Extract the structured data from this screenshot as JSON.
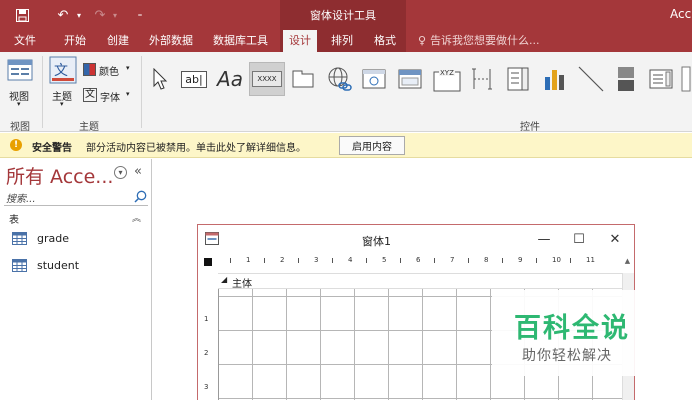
{
  "titlebar": {
    "context_title": "窗体设计工具",
    "app_title": "Acc"
  },
  "tabs": [
    {
      "label": "文件"
    },
    {
      "label": "开始"
    },
    {
      "label": "创建"
    },
    {
      "label": "外部数据"
    },
    {
      "label": "数据库工具"
    },
    {
      "label": "设计"
    },
    {
      "label": "排列"
    },
    {
      "label": "格式"
    }
  ],
  "active_tab": "设计",
  "tell_me": "告诉我您想要做什么...",
  "ribbon": {
    "view_label": "视图",
    "theme_label": "主题",
    "color_label": "颜色",
    "font_label": "字体",
    "groups": {
      "views": "视图",
      "themes": "主题",
      "controls": "控件"
    },
    "controls": [
      {
        "icon": "select-pointer-icon"
      },
      {
        "icon": "textbox-icon",
        "text": "ab|"
      },
      {
        "icon": "label-icon",
        "text": "Aa"
      },
      {
        "icon": "button-icon",
        "text": "XXXX"
      },
      {
        "icon": "tab-control-icon"
      },
      {
        "icon": "hyperlink-icon"
      },
      {
        "icon": "web-browser-icon"
      },
      {
        "icon": "navigation-control-icon"
      },
      {
        "icon": "option-group-icon",
        "text": "XYZ"
      },
      {
        "icon": "page-break-icon"
      },
      {
        "icon": "combo-box-icon"
      },
      {
        "icon": "chart-icon"
      },
      {
        "icon": "line-icon"
      },
      {
        "icon": "toggle-button-icon"
      },
      {
        "icon": "list-box-icon"
      }
    ]
  },
  "security_bar": {
    "title": "安全警告",
    "message": "部分活动内容已被禁用。单击此处了解详细信息。",
    "button": "启用内容"
  },
  "nav_pane": {
    "title": "所有 Acce...",
    "search_placeholder": "搜索...",
    "section": "表",
    "items": [
      {
        "label": "grade"
      },
      {
        "label": "student"
      }
    ]
  },
  "form_window": {
    "title": "窗体1",
    "section": "主体",
    "ruler_marks": [
      "1",
      "2",
      "3",
      "4",
      "5",
      "6",
      "7",
      "8",
      "9",
      "10",
      "11"
    ],
    "vruler_marks": [
      "1",
      "2",
      "3"
    ]
  },
  "watermark": {
    "main": "百科全说",
    "sub": "助你轻松解决"
  },
  "colors": {
    "accent": "#a4373a",
    "context_band": "#8e2d30",
    "security_bg": "#fdf6c8",
    "watermark_green": "#2eb872"
  }
}
